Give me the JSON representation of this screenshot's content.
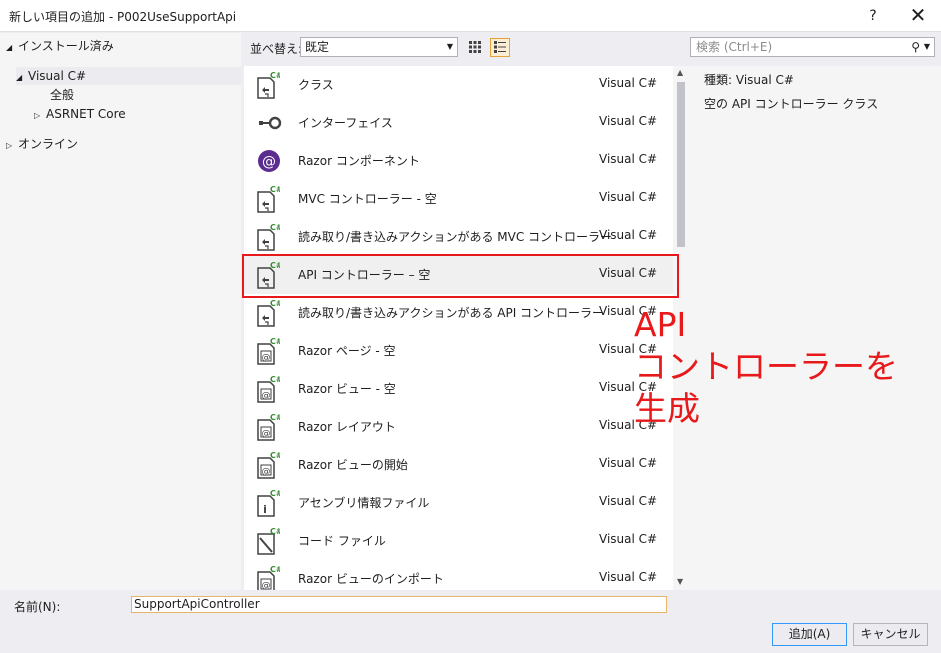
{
  "window": {
    "title": "新しい項目の追加 - P002UseSupportApi",
    "help": "?",
    "close": "✕"
  },
  "sidebar": {
    "installed": "インストール済み",
    "visual_csharp": "Visual C#",
    "all": "全般",
    "aspnet_core": "ASRNET Core",
    "online": "オンライン"
  },
  "toolbar": {
    "sort_label": "並べ替え:",
    "sort_value": "既定",
    "search_placeholder": "検索 (Ctrl+E)"
  },
  "templates": [
    {
      "name": "クラス",
      "lang": "Visual C#",
      "icon": "class-template-icon"
    },
    {
      "name": "インターフェイス",
      "lang": "Visual C#",
      "icon": "interface-icon"
    },
    {
      "name": "Razor コンポーネント",
      "lang": "Visual C#",
      "icon": "razor-component-icon"
    },
    {
      "name": "MVC コントローラー - 空",
      "lang": "Visual C#",
      "icon": "class-template-icon"
    },
    {
      "name": "読み取り/書き込みアクションがある MVC コントローラー",
      "lang": "Visual C#",
      "icon": "class-template-icon"
    },
    {
      "name": "API コントローラー – 空",
      "lang": "Visual C#",
      "icon": "class-template-icon"
    },
    {
      "name": "読み取り/書き込みアクションがある API コントローラー",
      "lang": "Visual C#",
      "icon": "class-template-icon"
    },
    {
      "name": "Razor ページ - 空",
      "lang": "Visual C#",
      "icon": "razor-page-icon"
    },
    {
      "name": "Razor ビュー - 空",
      "lang": "Visual C#",
      "icon": "razor-page-icon"
    },
    {
      "name": "Razor レイアウト",
      "lang": "Visual C#",
      "icon": "razor-page-icon"
    },
    {
      "name": "Razor ビューの開始",
      "lang": "Visual C#",
      "icon": "razor-page-icon"
    },
    {
      "name": "アセンブリ情報ファイル",
      "lang": "Visual C#",
      "icon": "info-file-icon"
    },
    {
      "name": "コード ファイル",
      "lang": "Visual C#",
      "icon": "code-file-icon"
    },
    {
      "name": "Razor ビューのインポート",
      "lang": "Visual C#",
      "icon": "razor-page-icon"
    }
  ],
  "details": {
    "type_label": "種類:",
    "type_value": "Visual C#",
    "description": "空の API コントローラー クラス"
  },
  "annotation": "API\nコントローラーを\n生成",
  "name_field": {
    "label": "名前(N):",
    "value": "SupportApiController"
  },
  "buttons": {
    "add": "追加(A)",
    "cancel": "キャンセル"
  },
  "colors": {
    "annotation": "#e8191b",
    "csharp_badge": "#388a34",
    "razor": "#5c2d91"
  }
}
